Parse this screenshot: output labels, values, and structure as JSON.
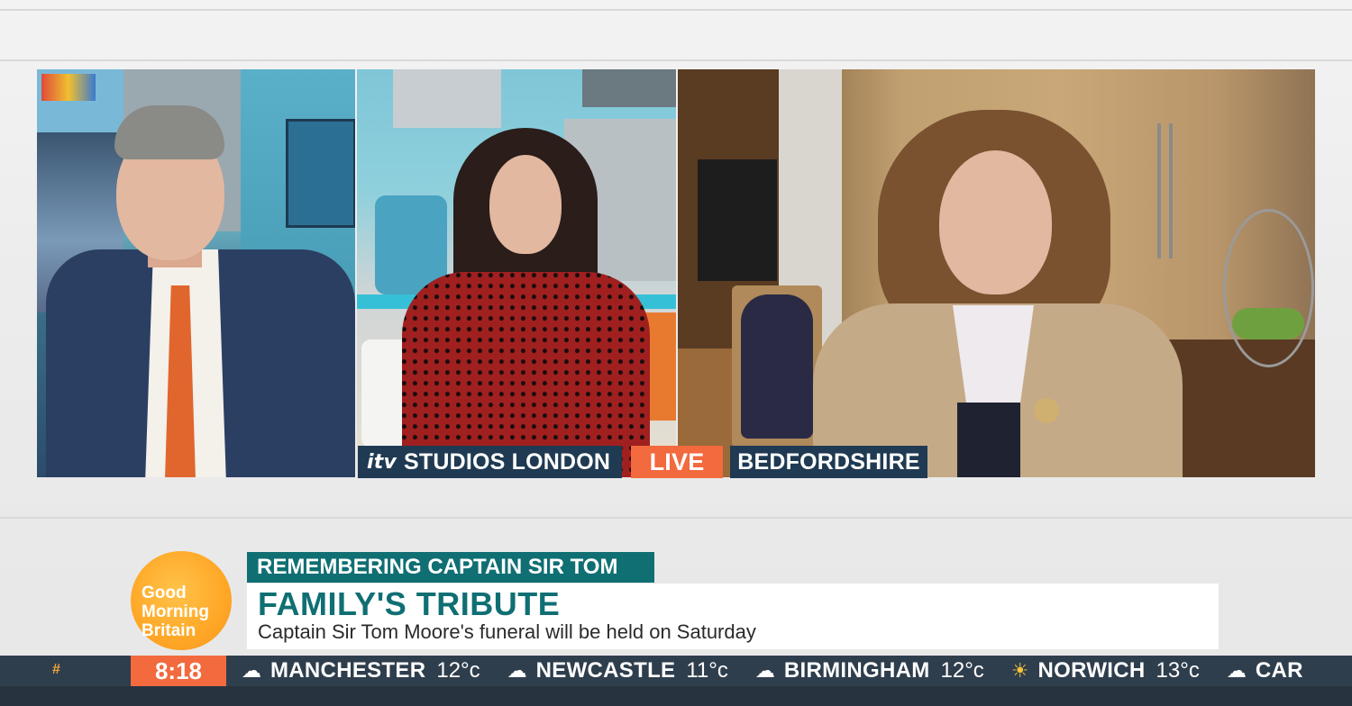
{
  "captions": {
    "studio_brand": "itv",
    "studio_location": "STUDIOS LONDON",
    "live": "LIVE",
    "remote_location": "BEDFORDSHIRE"
  },
  "logo": {
    "line1": "Good",
    "line2": "Morning",
    "line3": "Britain"
  },
  "strap": {
    "kicker": "REMEMBERING CAPTAIN SIR TOM",
    "headline": "FAMILY'S TRIBUTE",
    "subline": "Captain Sir Tom Moore's funeral will be held on Saturday"
  },
  "ticker": {
    "hash": "#",
    "time": "8:18",
    "weather": [
      {
        "icon": "cloud-icon",
        "city": "MANCHESTER",
        "temp": "12°c"
      },
      {
        "icon": "cloud-icon",
        "city": "NEWCASTLE",
        "temp": "11°c"
      },
      {
        "icon": "cloud-icon",
        "city": "BIRMINGHAM",
        "temp": "12°c"
      },
      {
        "icon": "sun-cloud-icon",
        "city": "NORWICH",
        "temp": "13°c"
      },
      {
        "icon": "cloud-icon",
        "city": "CAR",
        "temp": ""
      }
    ]
  },
  "colors": {
    "live_orange": "#f26a3d",
    "caption_navy": "#1f3a52",
    "strap_teal": "#0f6f73",
    "logo_orange": "#ffa726"
  }
}
